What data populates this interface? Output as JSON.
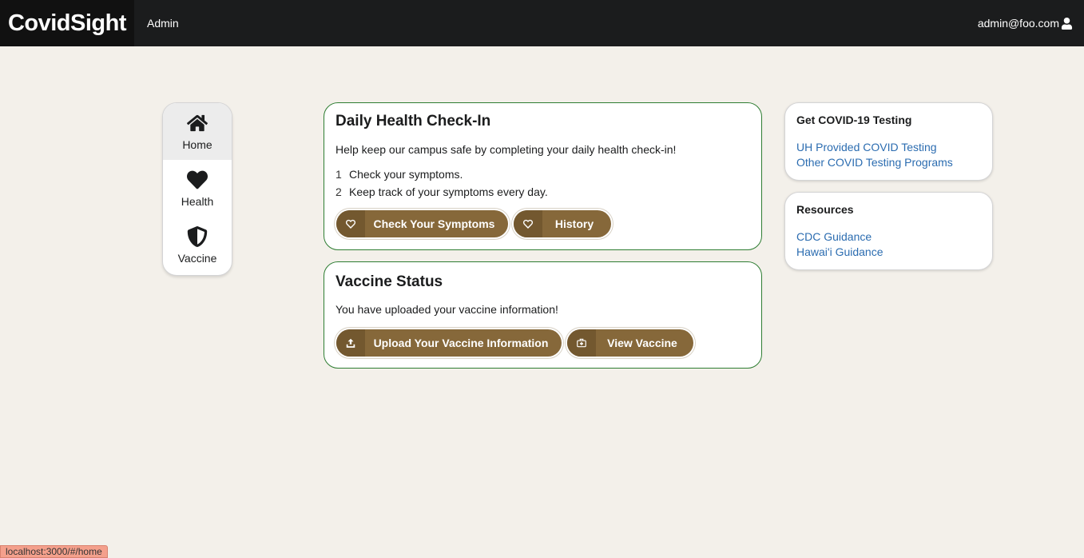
{
  "header": {
    "brand": "CovidSight",
    "nav_admin": "Admin",
    "user_email": "admin@foo.com"
  },
  "sidebar": {
    "items": [
      {
        "label": "Home",
        "icon": "home-icon",
        "active": true
      },
      {
        "label": "Health",
        "icon": "heart-icon",
        "active": false
      },
      {
        "label": "Vaccine",
        "icon": "shield-icon",
        "active": false
      }
    ]
  },
  "checkin": {
    "title": "Daily Health Check-In",
    "description": "Help keep our campus safe by completing your daily health check-in!",
    "steps": [
      {
        "num": "1",
        "text": "Check your symptoms."
      },
      {
        "num": "2",
        "text": "Keep track of your symptoms every day."
      }
    ],
    "check_button": "Check Your Symptoms",
    "history_button": "History"
  },
  "vaccine": {
    "title": "Vaccine Status",
    "description": "You have uploaded your vaccine information!",
    "upload_button": "Upload Your Vaccine Information",
    "view_button": "View Vaccine"
  },
  "testing": {
    "title": "Get COVID-19 Testing",
    "links": [
      "UH Provided COVID Testing",
      "Other COVID Testing Programs"
    ]
  },
  "resources": {
    "title": "Resources",
    "links": [
      "CDC Guidance",
      "Hawai'i Guidance"
    ]
  },
  "status_url": "localhost:3000/#/home",
  "colors": {
    "topbar": "#1b1c1d",
    "background": "#f3f0ea",
    "button": "#86683a",
    "card_border": "#2e7d32",
    "link": "#2b6cb0"
  }
}
